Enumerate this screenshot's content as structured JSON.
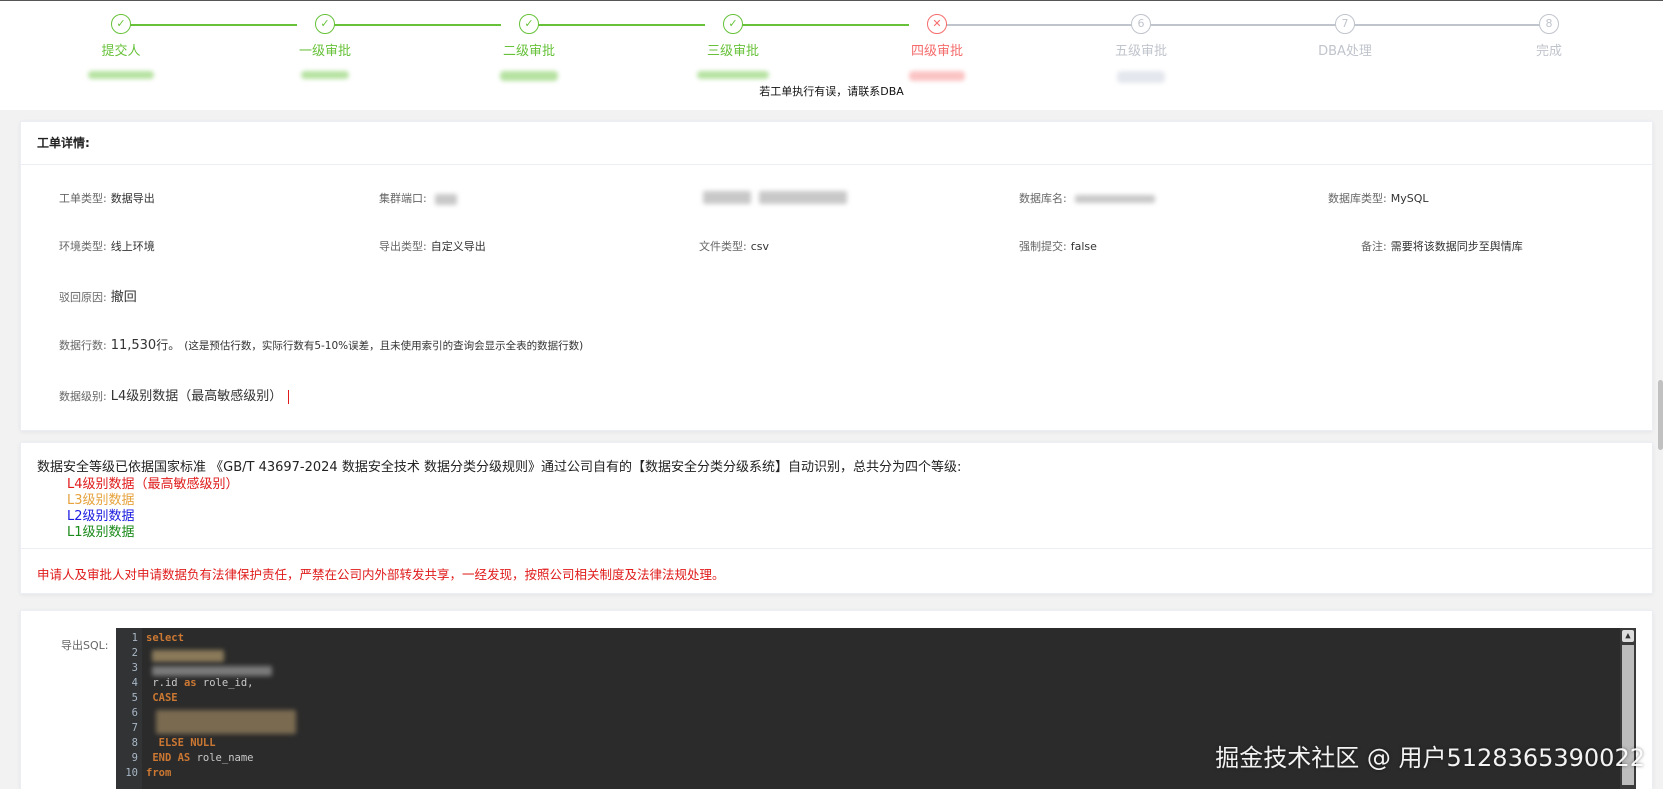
{
  "steps": [
    {
      "title": "提交人",
      "status": "done",
      "icon": "check-icon"
    },
    {
      "title": "一级审批",
      "status": "done",
      "icon": "check-icon"
    },
    {
      "title": "二级审批",
      "status": "done",
      "icon": "check-icon"
    },
    {
      "title": "三级审批",
      "status": "done",
      "icon": "check-icon"
    },
    {
      "title": "四级审批",
      "status": "error",
      "icon": "close-icon"
    },
    {
      "title": "五级审批",
      "status": "wait",
      "number": "6"
    },
    {
      "title": "DBA处理",
      "status": "wait",
      "number": "7"
    },
    {
      "title": "完成",
      "status": "wait",
      "number": "8"
    }
  ],
  "notice": "若工单执行有误，请联系DBA",
  "detail": {
    "header": "工单详情:",
    "fields": {
      "order_type": {
        "label": "工单类型:",
        "value": "数据导出"
      },
      "cluster_port": {
        "label": "集群端口:"
      },
      "db_name": {
        "label": "数据库名:"
      },
      "db_type": {
        "label": "数据库类型:",
        "value": "MySQL"
      },
      "env_type": {
        "label": "环境类型:",
        "value": "线上环境"
      },
      "export_type": {
        "label": "导出类型:",
        "value": "自定义导出"
      },
      "file_type": {
        "label": "文件类型:",
        "value": "csv"
      },
      "force_submit": {
        "label": "强制提交:",
        "value": "false"
      },
      "remark": {
        "label": "备注:",
        "value": "需要将该数据同步至舆情库"
      },
      "reject_reason": {
        "label": "驳回原因:",
        "value": "撤回"
      },
      "row_count": {
        "label": "数据行数:",
        "value": "11,530",
        "unit": "行。",
        "note": "(这是预估行数，实际行数有5-10%误差，且未使用索引的查询会显示全表的数据行数)"
      },
      "data_level": {
        "label": "数据级别:",
        "value": "L4级别数据（最高敏感级别）"
      }
    }
  },
  "security": {
    "intro": "数据安全等级已依据国家标准 《GB/T 43697-2024 数据安全技术 数据分类分级规则》通过公司自有的【数据安全分类分级系统】自动识别，总共分为四个等级:",
    "levels": [
      {
        "text": "L4级别数据（最高敏感级别）",
        "color": "#e01b1b"
      },
      {
        "text": "L3级别数据",
        "color": "#e6a23c"
      },
      {
        "text": "L2级别数据",
        "color": "#1a1ae0"
      },
      {
        "text": "L1级别数据",
        "color": "#1a8a1a"
      }
    ],
    "warning": "申请人及审批人对申请数据负有法律保护责任，严禁在公司内外部转发共享，一经发现，按照公司相关制度及法律法规处理。"
  },
  "sql": {
    "label": "导出SQL:",
    "lines": [
      {
        "n": "1",
        "parts": [
          {
            "t": "select",
            "kw": true
          }
        ]
      },
      {
        "n": "2",
        "parts": []
      },
      {
        "n": "3",
        "parts": []
      },
      {
        "n": "4",
        "parts": [
          {
            "t": " r.id "
          },
          {
            "t": "as",
            "kw": true
          },
          {
            "t": " role_id,"
          }
        ]
      },
      {
        "n": "5",
        "parts": [
          {
            "t": " CASE",
            "kw": true
          }
        ]
      },
      {
        "n": "6",
        "parts": []
      },
      {
        "n": "7",
        "parts": []
      },
      {
        "n": "8",
        "parts": [
          {
            "t": "  ELSE NULL",
            "kw": true
          }
        ]
      },
      {
        "n": "9",
        "parts": [
          {
            "t": " END AS",
            "kw": true
          },
          {
            "t": " role_name"
          }
        ]
      },
      {
        "n": "10",
        "parts": [
          {
            "t": "from",
            "kw": true
          }
        ]
      }
    ]
  },
  "watermark": "掘金技术社区 @ 用户5128365390022",
  "colors": {
    "done": "#67c23a",
    "error": "#f56c6c",
    "wait": "#c0c4cc",
    "danger": "#e01b1b"
  }
}
